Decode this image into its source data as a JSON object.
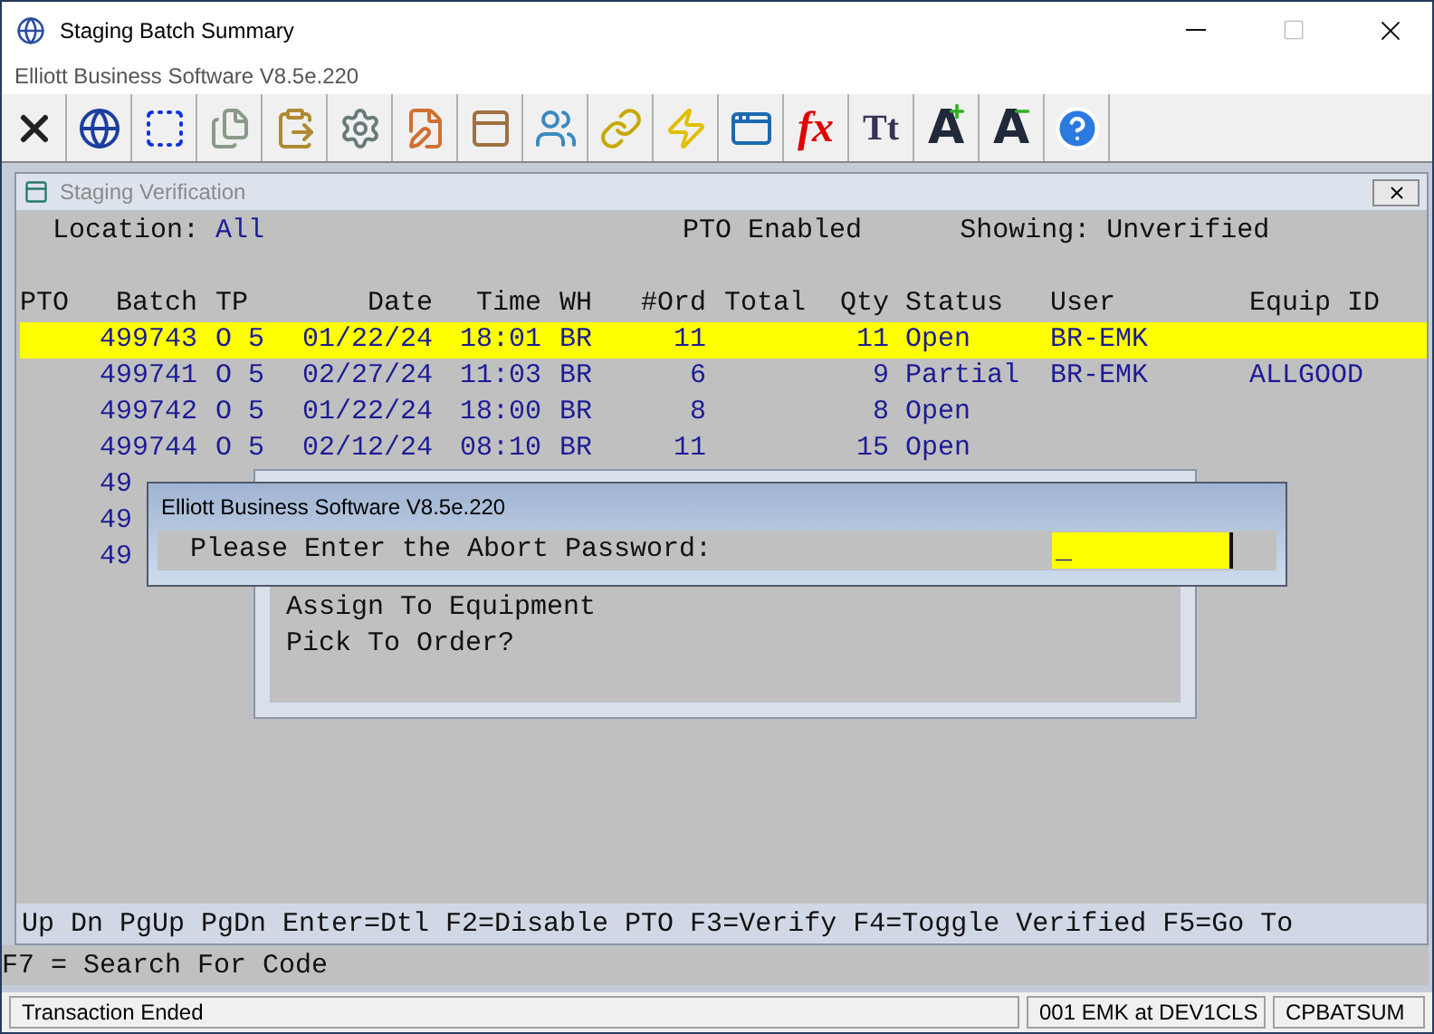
{
  "window": {
    "title": "Staging Batch Summary",
    "subtitle": "Elliott Business Software V8.5e.220"
  },
  "toolbar_glyphs": [
    {
      "text": "fx",
      "kind": "formula"
    },
    {
      "text": "Tt",
      "kind": "font"
    },
    {
      "text": "A",
      "kind": "grow"
    },
    {
      "text": "A",
      "kind": "shrink"
    }
  ],
  "panel": {
    "title": "Staging Verification",
    "location_label": "Location:",
    "location": "All",
    "pto": "PTO Enabled",
    "showing_label": "Showing:",
    "showing": "Unverified"
  },
  "table": {
    "columns": [
      "PTO",
      "Batch",
      "TP",
      "Date",
      "Time",
      "WH",
      "#Ord",
      "Total",
      "Qty",
      "Status",
      "User",
      "Equip ID"
    ],
    "rows": [
      {
        "selected": true,
        "cells": {
          "batch": "499743",
          "tp": "O 5",
          "date": "01/22/24",
          "time": "18:01",
          "wh": "BR",
          "ord": "11",
          "qty": "11",
          "status": "Open",
          "user": "BR-EMK"
        }
      },
      {
        "selected": false,
        "cells": {
          "batch": "499741",
          "tp": "O 5",
          "date": "02/27/24",
          "time": "11:03",
          "wh": "BR",
          "ord": "6",
          "qty": "9",
          "status": "Partial",
          "user": "BR-EMK",
          "equip": "ALLGOOD"
        }
      },
      {
        "selected": false,
        "cells": {
          "batch": "499742",
          "tp": "O 5",
          "date": "01/22/24",
          "time": "18:00",
          "wh": "BR",
          "ord": "8",
          "qty": "8",
          "status": "Open"
        }
      },
      {
        "selected": false,
        "cells": {
          "batch": "499744",
          "tp": "O 5",
          "date": "02/12/24",
          "time": "08:10",
          "wh": "BR",
          "ord": "11",
          "qty": "15",
          "status": "Open"
        }
      },
      {
        "selected": false,
        "cells": {
          "batch": "49"
        }
      },
      {
        "selected": false,
        "cells": {
          "batch": "49"
        }
      },
      {
        "selected": false,
        "cells": {
          "batch": "49"
        }
      }
    ]
  },
  "menu_dialog": {
    "lines": [
      "Assign To Equipment",
      "Pick To Order?"
    ]
  },
  "password_dialog": {
    "title": "Elliott Business Software V8.5e.220",
    "prompt": "Please Enter the Abort Password:",
    "value": "_"
  },
  "key_help": "Up Dn PgUp PgDn Enter=Dtl F2=Disable PTO F3=Verify F4=Toggle Verified F5=Go To",
  "key_help_2": "F7 = Search For Code",
  "status_bar": [
    "Transaction Ended",
    "001 EMK at DEV1CLS",
    "CPBATSUM"
  ]
}
